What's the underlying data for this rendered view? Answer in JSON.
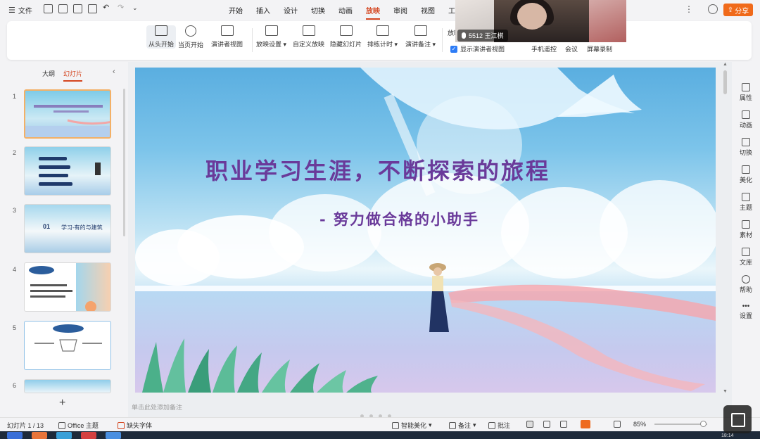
{
  "menubar": {
    "file_label": "文件",
    "tabs": [
      "开始",
      "插入",
      "设计",
      "切换",
      "动画",
      "放映",
      "审阅",
      "视图",
      "工"
    ],
    "active_tab": "放映",
    "share_label": "分享"
  },
  "ribbon": {
    "buttons": [
      {
        "label": "从头开始",
        "icon": "play-from-start-icon"
      },
      {
        "label": "当页开始",
        "icon": "play-current-icon"
      },
      {
        "label": "演讲者视图",
        "icon": "presenter-view-icon"
      },
      {
        "label": "放映设置",
        "icon": "slideshow-settings-icon",
        "dropdown": true
      },
      {
        "label": "自定义放映",
        "icon": "custom-show-icon"
      },
      {
        "label": "隐藏幻灯片",
        "icon": "hide-slide-icon"
      },
      {
        "label": "排练计时",
        "icon": "rehearse-timing-icon",
        "dropdown": true
      },
      {
        "label": "演讲备注",
        "icon": "speaker-notes-icon",
        "dropdown": true
      }
    ],
    "playback_label": "放映",
    "show_presenter_checkbox": "显示演讲者视图",
    "remote_label": "手机遥控",
    "meeting_label": "会议",
    "record_label": "屏幕录制"
  },
  "webcam": {
    "caption": "5512 王江棋"
  },
  "left_panel": {
    "tab_outline": "大纲",
    "tab_slides": "幻灯片",
    "slide_numbers": [
      "1",
      "2",
      "3",
      "4",
      "5",
      "6"
    ],
    "thumb3_text": "学习-有的与建筑",
    "thumb3_num": "01"
  },
  "slide": {
    "title": "职业学习生涯，不断探索的旅程",
    "subtitle": "- 努力做合格的小助手"
  },
  "notes_placeholder": "单击此处添加备注",
  "status_bar": {
    "slide_counter": "幻灯片 1 / 13",
    "theme": "Office 主题",
    "missing_font": "缺失字体",
    "smart_beautify": "智能美化",
    "notes": "备注",
    "comments": "批注",
    "zoom": "85%"
  },
  "right_toolbar": [
    {
      "label": "属性",
      "icon": "properties-icon"
    },
    {
      "label": "动画",
      "icon": "star-icon"
    },
    {
      "label": "切换",
      "icon": "transition-icon"
    },
    {
      "label": "美化",
      "icon": "beautify-icon"
    },
    {
      "label": "主题",
      "icon": "theme-icon"
    },
    {
      "label": "素材",
      "icon": "assets-icon"
    },
    {
      "label": "文库",
      "icon": "library-icon"
    },
    {
      "label": "帮助",
      "icon": "help-icon"
    },
    {
      "label": "设置",
      "icon": "settings-icon"
    }
  ],
  "taskbar": {
    "time": "18:14"
  },
  "colors": {
    "accent": "#d4451f",
    "share_bg": "#f06a1a",
    "title_purple": "#6a3a9a"
  }
}
